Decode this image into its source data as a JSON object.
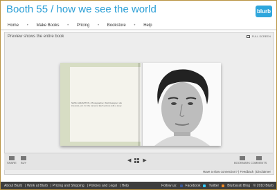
{
  "header": {
    "title": "Booth 55 / how we see the world",
    "logo_text": "blurb"
  },
  "nav": {
    "items": [
      {
        "label": "Home"
      },
      {
        "label": "Make Books"
      },
      {
        "label": "Pricing"
      },
      {
        "label": "Bookstore"
      },
      {
        "label": "Help"
      }
    ]
  },
  "viewer": {
    "preview_note": "Preview shows the entire book",
    "fullscreen_label": "FULL SCREEN"
  },
  "book": {
    "left_page_text": "NATE JARAMITOS • Photographer, Web Designer. His interests, etc. for the camera. Each picture tells a story."
  },
  "toolbar": {
    "left_tools": [
      {
        "label": "SHARE",
        "icon": "share-icon"
      },
      {
        "label": "BUY",
        "icon": "cart-icon"
      }
    ],
    "right_tools": [
      {
        "label": "BOOKMARK",
        "icon": "bookmark-icon"
      },
      {
        "label": "COMMENTS",
        "icon": "comments-icon"
      }
    ]
  },
  "connection": {
    "text": "Have a slow connection?",
    "feedback": "Feedback",
    "disclaimer": "Disclaimer"
  },
  "footer": {
    "links": [
      {
        "label": "About Blurb"
      },
      {
        "label": "Work at Blurb"
      },
      {
        "label": "Pricing and Shipping"
      },
      {
        "label": "Policies and Legal"
      },
      {
        "label": "Help"
      }
    ],
    "follow_us": "Follow us:",
    "social": [
      {
        "label": "Facebook",
        "icon": "facebook-icon",
        "color": "#3b5998"
      },
      {
        "label": "Twitter",
        "icon": "twitter-icon",
        "color": "#33ccff"
      },
      {
        "label": "Blurbarati Blog",
        "icon": "blog-icon",
        "color": "#f08a24"
      }
    ],
    "copyright": "© 2010 Blurb"
  },
  "colors": {
    "title_blue": "#2b9fd6",
    "page_border": "#b89240",
    "footer_bg": "#3d3d3d"
  }
}
